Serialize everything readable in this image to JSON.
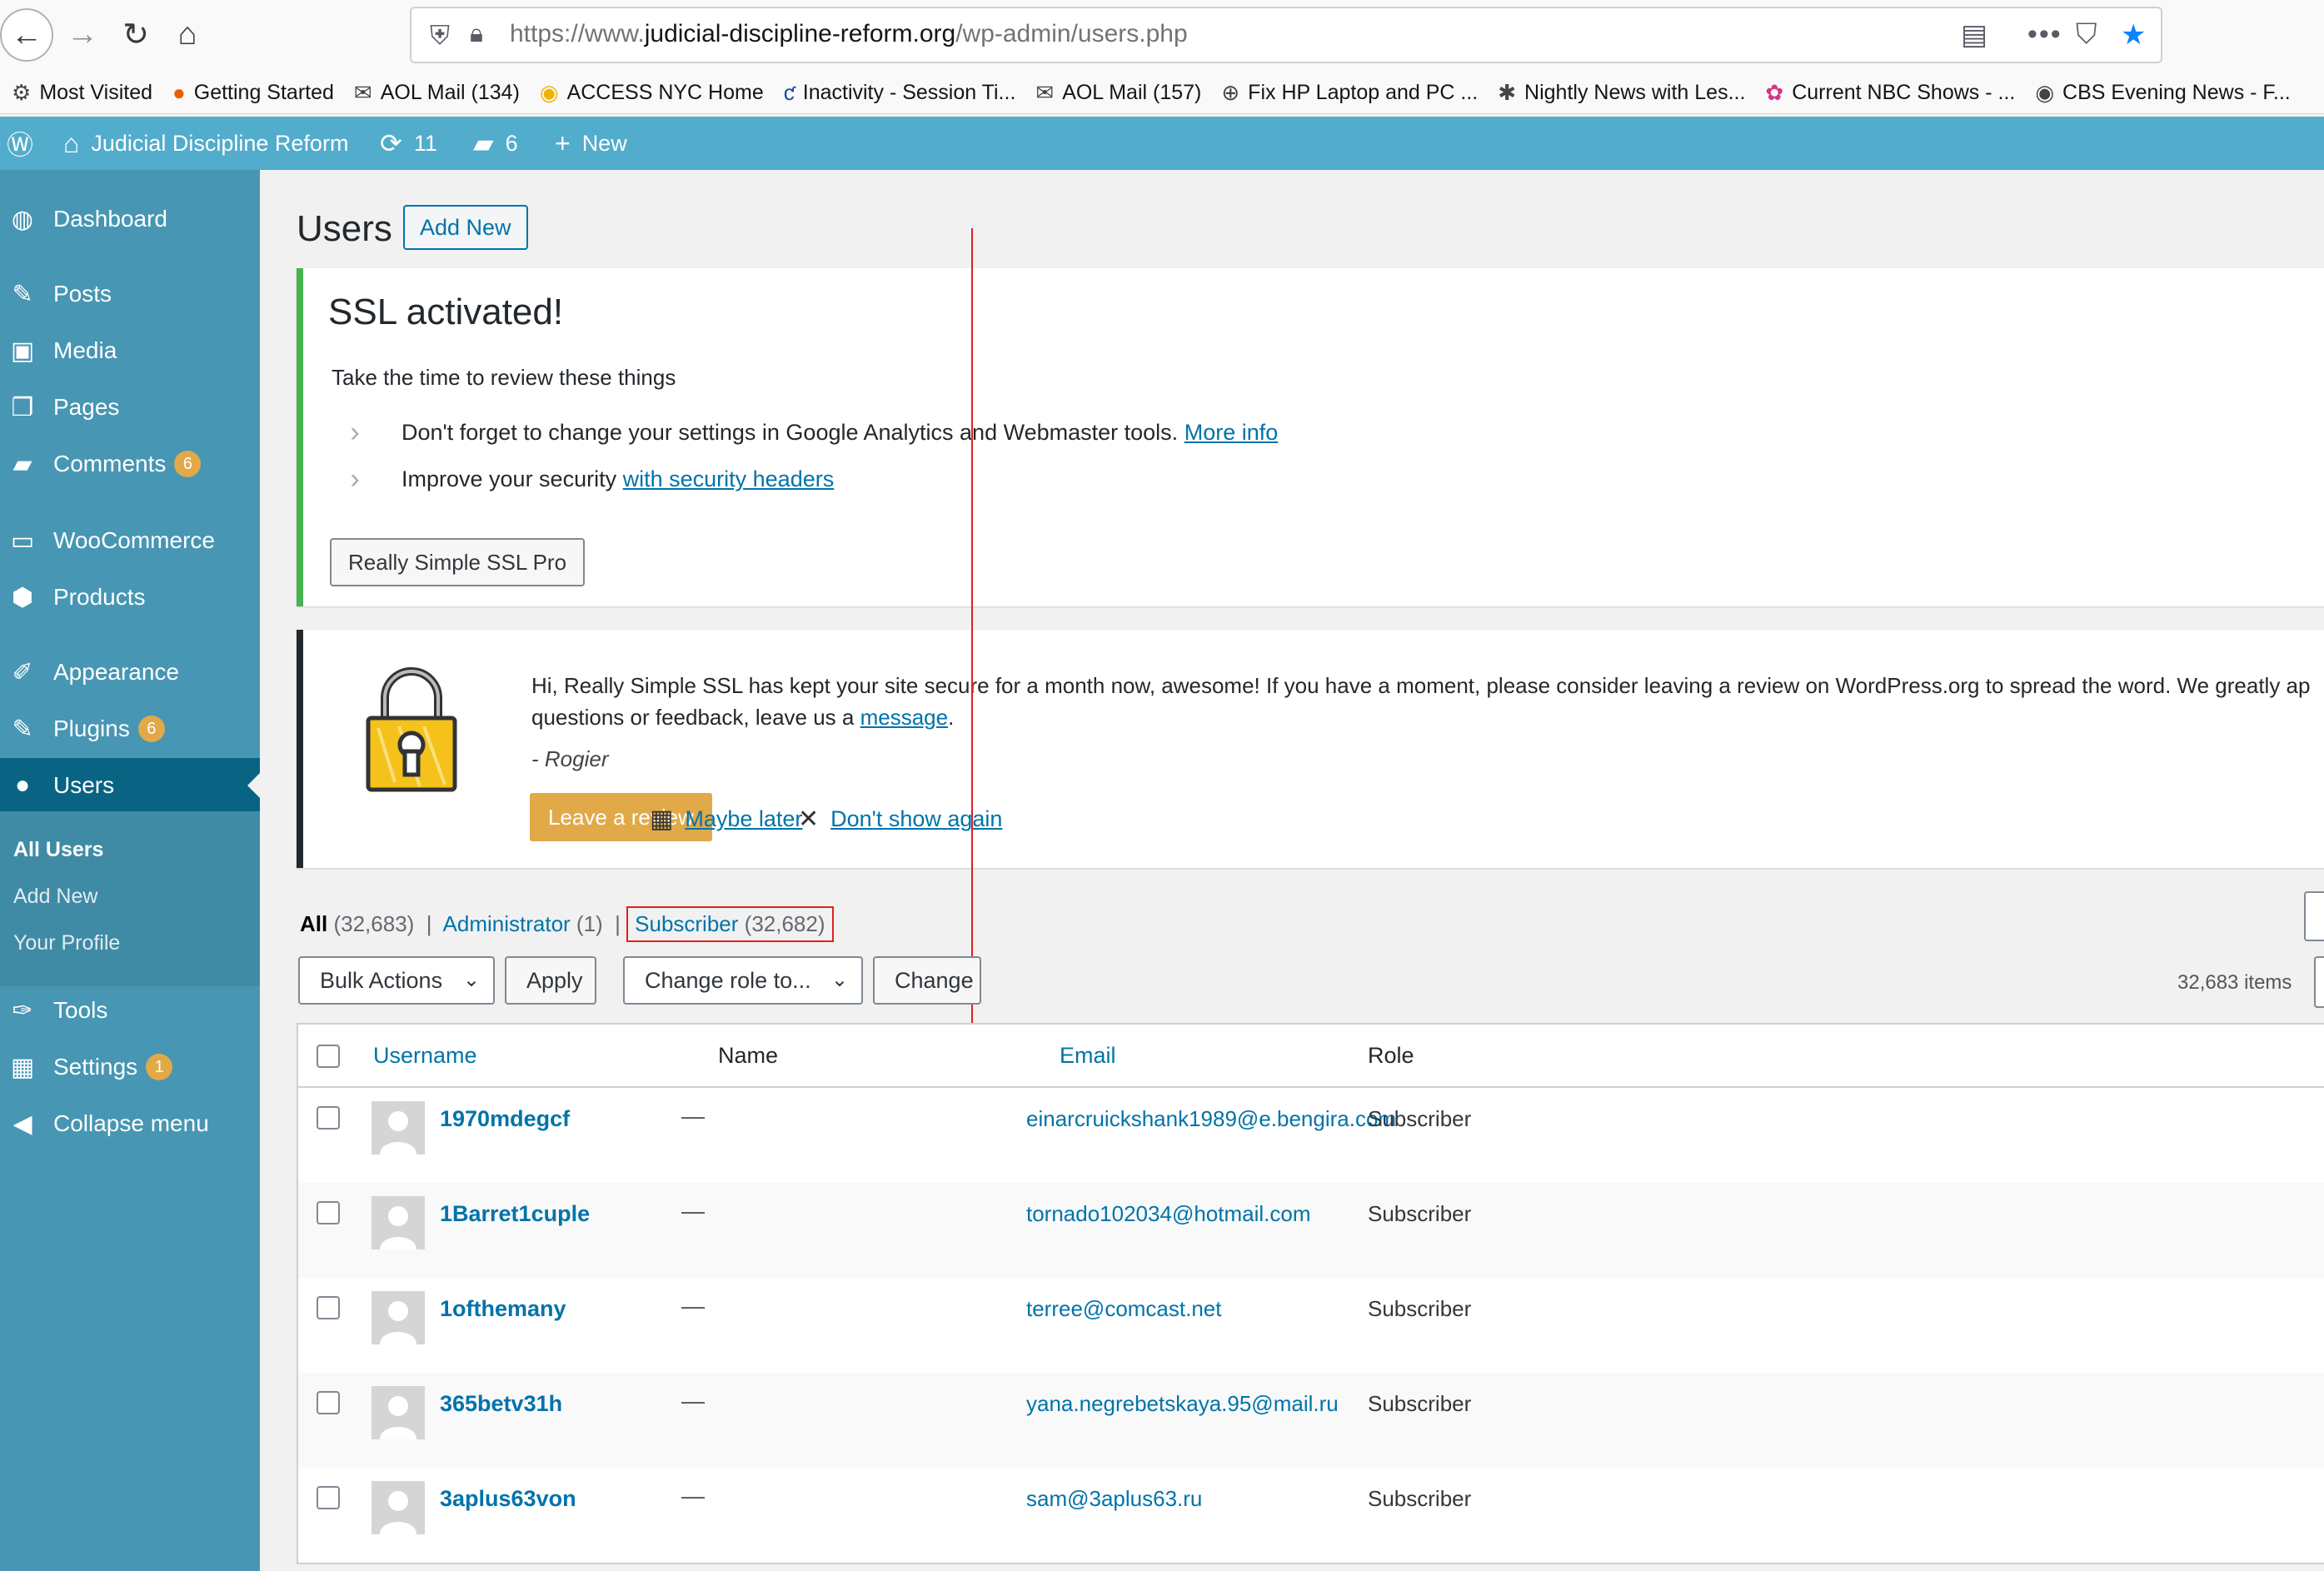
{
  "browser": {
    "url_domain": "judicial-discipline-reform.org",
    "url_prefix": "https://www.",
    "url_path": "/wp-admin/users.php",
    "bookmarks": [
      {
        "label": "Most Visited",
        "icon": "gear-icon",
        "glyph": "⚙"
      },
      {
        "label": "Getting Started",
        "icon": "firefox-icon",
        "glyph": "●"
      },
      {
        "label": "AOL Mail (134)",
        "icon": "aol-icon",
        "glyph": "✉"
      },
      {
        "label": "ACCESS NYC Home",
        "icon": "access-nyc-icon",
        "glyph": "◉"
      },
      {
        "label": "Inactivity - Session Ti...",
        "icon": "citi-icon",
        "glyph": "ƈ"
      },
      {
        "label": "AOL Mail (157)",
        "icon": "aol-icon",
        "glyph": "✉"
      },
      {
        "label": "Fix HP Laptop and PC ...",
        "icon": "globe-icon",
        "glyph": "⊕"
      },
      {
        "label": "Nightly News with Les...",
        "icon": "nbc-icon",
        "glyph": "✱"
      },
      {
        "label": "Current NBC Shows - ...",
        "icon": "nbc-peacock-icon",
        "glyph": "✿"
      },
      {
        "label": "CBS Evening News - F...",
        "icon": "cbs-icon",
        "glyph": "◉"
      }
    ]
  },
  "admin_bar": {
    "site_name": "Judicial Discipline Reform",
    "updates_count": "11",
    "comments_count": "6",
    "new_label": "New"
  },
  "sidebar": {
    "items": [
      {
        "label": "Dashboard",
        "icon": "dashboard-icon",
        "glyph": "◍",
        "count": ""
      },
      {
        "label": "Posts",
        "icon": "pin-icon",
        "glyph": "✎",
        "count": ""
      },
      {
        "label": "Media",
        "icon": "media-icon",
        "glyph": "▣",
        "count": ""
      },
      {
        "label": "Pages",
        "icon": "pages-icon",
        "glyph": "❐",
        "count": ""
      },
      {
        "label": "Comments",
        "icon": "comment-icon",
        "glyph": "▰",
        "count": "6"
      },
      {
        "label": "WooCommerce",
        "icon": "woocommerce-icon",
        "glyph": "▭",
        "count": ""
      },
      {
        "label": "Products",
        "icon": "box-icon",
        "glyph": "⬢",
        "count": ""
      },
      {
        "label": "Appearance",
        "icon": "brush-icon",
        "glyph": "✐",
        "count": ""
      },
      {
        "label": "Plugins",
        "icon": "plug-icon",
        "glyph": "✎",
        "count": "6"
      },
      {
        "label": "Users",
        "icon": "user-icon",
        "glyph": "●",
        "count": ""
      },
      {
        "label": "Tools",
        "icon": "wrench-icon",
        "glyph": "✑",
        "count": ""
      },
      {
        "label": "Settings",
        "icon": "settings-icon",
        "glyph": "▦",
        "count": "1"
      },
      {
        "label": "Collapse menu",
        "icon": "collapse-icon",
        "glyph": "◀",
        "count": ""
      }
    ],
    "submenu": [
      "All Users",
      "Add New",
      "Your Profile"
    ]
  },
  "page": {
    "title": "Users",
    "add_new": "Add New"
  },
  "ssl_notice": {
    "title": "SSL activated!",
    "subtitle": "Take the time to review these things",
    "item1_text": "Don't forget to change your settings in Google Analytics and Webmaster tools.",
    "item1_link": "More info",
    "item2_text": "Improve your security",
    "item2_link": "with security headers",
    "button": "Really Simple SSL Pro"
  },
  "review_notice": {
    "text_line1": "Hi, Really Simple SSL has kept your site secure for a month now, awesome! If you have a moment, please consider leaving a review on WordPress.org to spread the word. We greatly ap",
    "text_line2_before": "questions or feedback, leave us a",
    "text_line2_link": "message",
    "signature": "- Rogier",
    "leave_review": "Leave a review",
    "maybe_later": "Maybe later",
    "dont_show": "Don't show again"
  },
  "filters": {
    "all_label": "All",
    "all_count": "(32,683)",
    "admin_label": "Administrator",
    "admin_count": "(1)",
    "subscriber_label": "Subscriber",
    "subscriber_count": "(32,682)"
  },
  "tablenav": {
    "bulk_actions": "Bulk Actions",
    "apply": "Apply",
    "change_role": "Change role to...",
    "change": "Change",
    "items_count": "32,683 items"
  },
  "table": {
    "headers": {
      "username": "Username",
      "name": "Name",
      "email": "Email",
      "role": "Role"
    },
    "rows": [
      {
        "username": "1970mdegcf",
        "name": "—",
        "email": "einarcruickshank1989@e.bengira.com",
        "role": "Subscriber"
      },
      {
        "username": "1Barret1cuple",
        "name": "—",
        "email": "tornado102034@hotmail.com",
        "role": "Subscriber"
      },
      {
        "username": "1ofthemany",
        "name": "—",
        "email": "terree@comcast.net",
        "role": "Subscriber"
      },
      {
        "username": "365betv31h",
        "name": "—",
        "email": "yana.negrebetskaya.95@mail.ru",
        "role": "Subscriber"
      },
      {
        "username": "3aplus63von",
        "name": "—",
        "email": "sam@3aplus63.ru",
        "role": "Subscriber"
      }
    ]
  },
  "colors": {
    "admin_bar": "#52accc",
    "sidebar": "#4796b3",
    "sidebar_active": "#096484",
    "link": "#0073aa",
    "annotation": "#e02020",
    "ssl_border": "#46b450",
    "review_button": "#e1a948"
  }
}
